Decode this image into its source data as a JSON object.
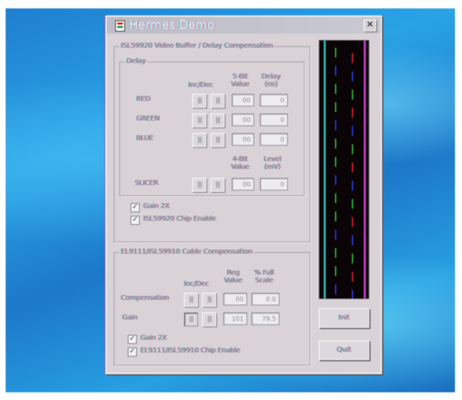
{
  "window": {
    "title": "Hermes Demo",
    "close_glyph": "✕"
  },
  "video_group": {
    "legend": "ISL59920 Video Buffer / Delay Compensation",
    "delay_group": {
      "legend": "Delay",
      "headers": {
        "incdec": "Inc/Dec",
        "value_5bit": "5-Bit\nValue",
        "delay_ns": "Delay\n(ns)"
      },
      "rows": [
        {
          "label": "RED",
          "inc": "|||",
          "dec": "|||",
          "value": "00",
          "delay": "0"
        },
        {
          "label": "GREEN",
          "inc": "|||",
          "dec": "|||",
          "value": "00",
          "delay": "0"
        },
        {
          "label": "BLUE",
          "inc": "|||",
          "dec": "|||",
          "value": "00",
          "delay": "0"
        }
      ],
      "slicer_headers": {
        "value_4bit": "4-Bit\nValue",
        "level_mv": "Level\n(mV)"
      },
      "slicer": {
        "label": "SLICER",
        "inc": "|||",
        "dec": "|||",
        "value": "00",
        "level": "0"
      }
    },
    "checkboxes": [
      {
        "label": "Gain 2X",
        "checked": true
      },
      {
        "label": "ISL59920 Chip Enable",
        "checked": true
      }
    ]
  },
  "cable_group": {
    "legend": "EL9111/ISL59910 Cable Compensation",
    "headers": {
      "incdec": "Inc/Dec",
      "reg_value": "Reg\nValue",
      "pct_full_scale": "% Full\nScale"
    },
    "rows": [
      {
        "label": "Compensation",
        "inc": "|||",
        "dec": "|||",
        "value": "00",
        "scale": "0.0"
      },
      {
        "label": "Gain",
        "inc": "|||",
        "dec": "|||",
        "value": "101",
        "scale": "79.5"
      }
    ],
    "checkboxes": [
      {
        "label": "Gain 2X",
        "checked": true
      },
      {
        "label": "EL9111/ISL59910 Chip Enable",
        "checked": true
      }
    ]
  },
  "buttons": {
    "init": "Init",
    "quit": "Quit"
  },
  "preview": {
    "colors": {
      "red": "#d21a2a",
      "green": "#27b23a",
      "blue": "#2a3ad6",
      "magenta": "#c83cc8"
    }
  }
}
